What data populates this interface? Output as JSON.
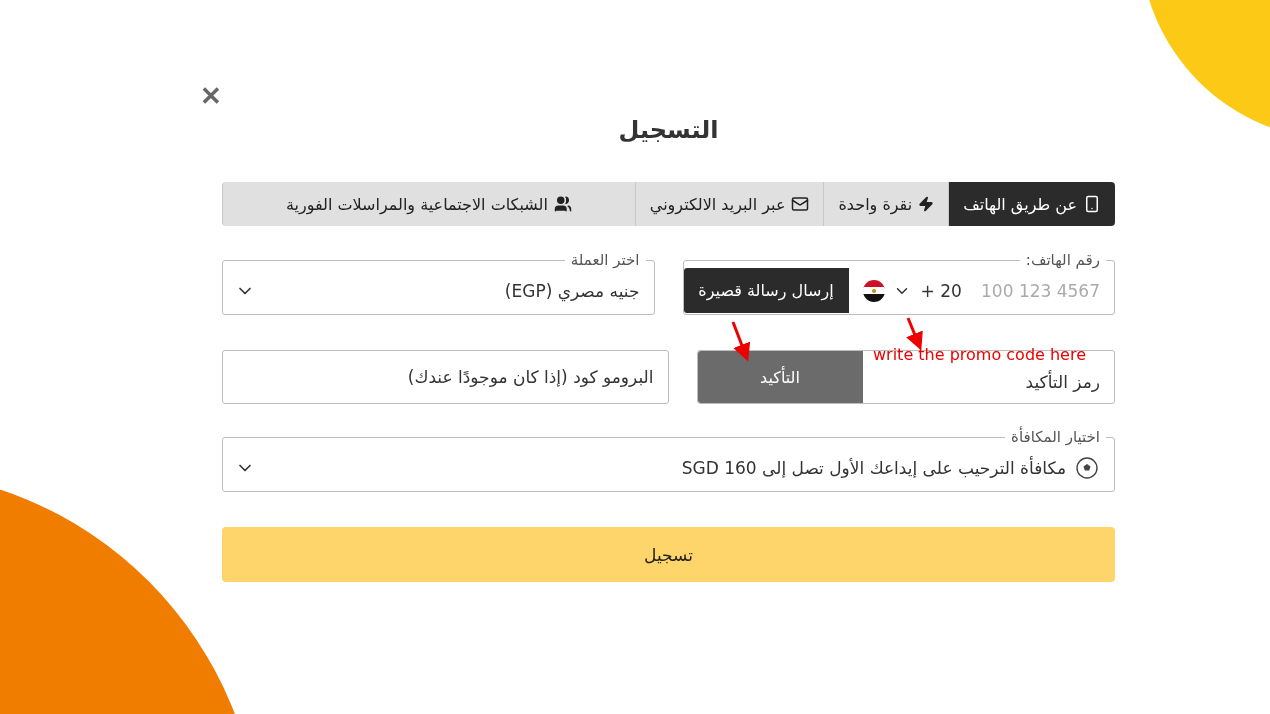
{
  "close_label": "✕",
  "title": "التسجيل",
  "tabs": [
    {
      "kind": "phone",
      "label": "عن طريق الهاتف",
      "selected": true
    },
    {
      "kind": "one_click",
      "label": "نقرة واحدة",
      "selected": false
    },
    {
      "kind": "email",
      "label": "عبر البريد الالكتروني",
      "selected": false
    },
    {
      "kind": "social",
      "label": "الشبكات الاجتماعية والمراسلات الفورية",
      "selected": false
    }
  ],
  "phone": {
    "label": "رقم الهاتف:",
    "placeholder": "100 123 4567",
    "country_code": "+ 20",
    "send_button": "إرسال رسالة قصيرة"
  },
  "currency": {
    "label": "اختر العملة",
    "value": "جنيه مصري (EGP)"
  },
  "confirmation": {
    "placeholder": "رمز التأكيد",
    "button": "التأكيد"
  },
  "promo": {
    "placeholder": "البرومو كود (إذا كان موجودًا عندك)"
  },
  "bonus": {
    "label": "اختيار المكافأة",
    "value": "مكافأة الترحيب على إيداعك الأول تصل إلى 160 SGD"
  },
  "register_button": "تسجيل",
  "annotation": {
    "text": "write the promo code here"
  }
}
